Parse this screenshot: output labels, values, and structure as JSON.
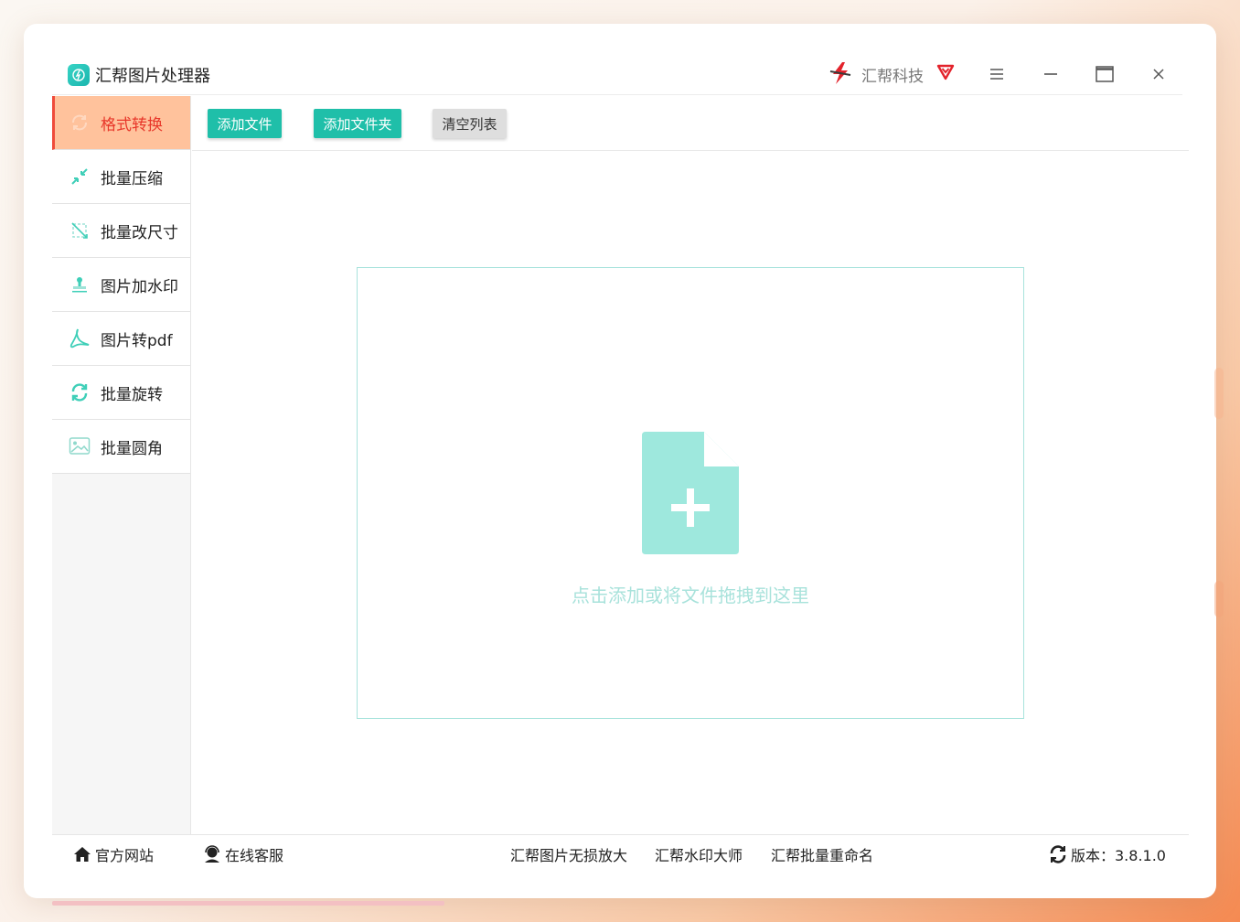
{
  "window": {
    "app_title": "汇帮图片处理器",
    "brand_name": "汇帮科技",
    "accent_color": "#1fbfa9",
    "active_color": "#e8372a"
  },
  "sidebar": {
    "items": [
      {
        "label": "格式转换",
        "icon": "convert-icon",
        "active": true
      },
      {
        "label": "批量压缩",
        "icon": "compress-icon",
        "active": false
      },
      {
        "label": "批量改尺寸",
        "icon": "resize-icon",
        "active": false
      },
      {
        "label": "图片加水印",
        "icon": "stamp-icon",
        "active": false
      },
      {
        "label": "图片转pdf",
        "icon": "pdf-icon",
        "active": false
      },
      {
        "label": "批量旋转",
        "icon": "rotate-icon",
        "active": false
      },
      {
        "label": "批量圆角",
        "icon": "image-round-icon",
        "active": false
      }
    ]
  },
  "toolbar": {
    "add_file": "添加文件",
    "add_folder": "添加文件夹",
    "clear_list": "清空列表"
  },
  "dropzone": {
    "hint": "点击添加或将文件拖拽到这里"
  },
  "footer": {
    "official_site": "官方网站",
    "online_service": "在线客服",
    "link_enlarge": "汇帮图片无损放大",
    "link_watermark": "汇帮水印大师",
    "link_rename": "汇帮批量重命名",
    "version_label": "版本：3.8.1.0"
  }
}
